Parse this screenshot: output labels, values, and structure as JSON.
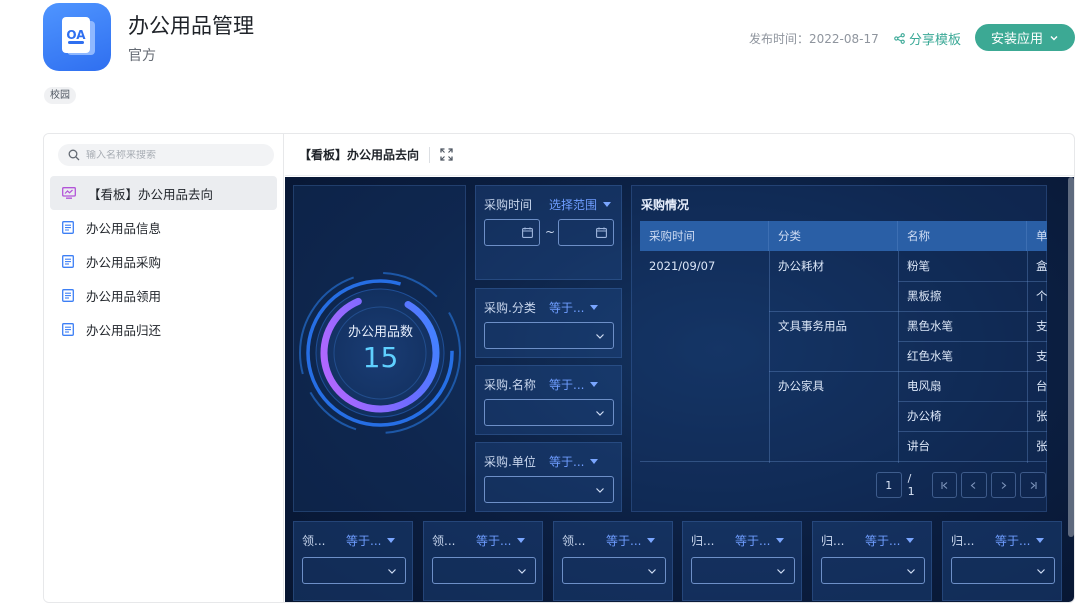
{
  "header": {
    "icon_text": "OA",
    "title": "办公用品管理",
    "subtitle": "官方",
    "publish_label": "发布时间：2022-08-17",
    "share_label": "分享模板",
    "install_label": "安装应用",
    "tag": "校园"
  },
  "sidebar": {
    "search_placeholder": "输入名称来搜索",
    "items": [
      {
        "label": "【看板】办公用品去向"
      },
      {
        "label": "办公用品信息"
      },
      {
        "label": "办公用品采购"
      },
      {
        "label": "办公用品领用"
      },
      {
        "label": "办公用品归还"
      }
    ]
  },
  "tab": {
    "title": "【看板】办公用品去向"
  },
  "dashboard": {
    "gauge": {
      "label": "办公用品数",
      "value": "15"
    },
    "filters": {
      "time_label": "采购时间",
      "time_range": "选择范围",
      "tilde": "~",
      "category_label": "采购.分类",
      "category_op": "等于...",
      "name_label": "采购.名称",
      "name_op": "等于...",
      "unit_label": "采购.单位",
      "unit_op": "等于..."
    },
    "table": {
      "title": "采购情况",
      "columns": [
        "采购时间",
        "分类",
        "名称",
        "单"
      ],
      "date": "2021/09/07",
      "categories": [
        "办公耗材",
        "文具事务用品",
        "办公家具"
      ],
      "names": [
        "粉笔",
        "黑板擦",
        "黑色水笔",
        "红色水笔",
        "电风扇",
        "办公椅",
        "讲台"
      ],
      "units": [
        "盒",
        "个",
        "支",
        "支",
        "台",
        "张",
        "张"
      ],
      "page_current": "1",
      "page_total": "/ 1"
    },
    "bottom_filters": [
      {
        "label": "领...",
        "op": "等于..."
      },
      {
        "label": "领...",
        "op": "等于..."
      },
      {
        "label": "领...",
        "op": "等于..."
      },
      {
        "label": "归...",
        "op": "等于..."
      },
      {
        "label": "归...",
        "op": "等于..."
      },
      {
        "label": "归...",
        "op": "等于..."
      }
    ]
  },
  "colors": {
    "accent": "#3ca994",
    "dashboard_bg": "#0b1e40",
    "table_header": "#2a5fa6",
    "link_blue": "#6e9dff"
  }
}
